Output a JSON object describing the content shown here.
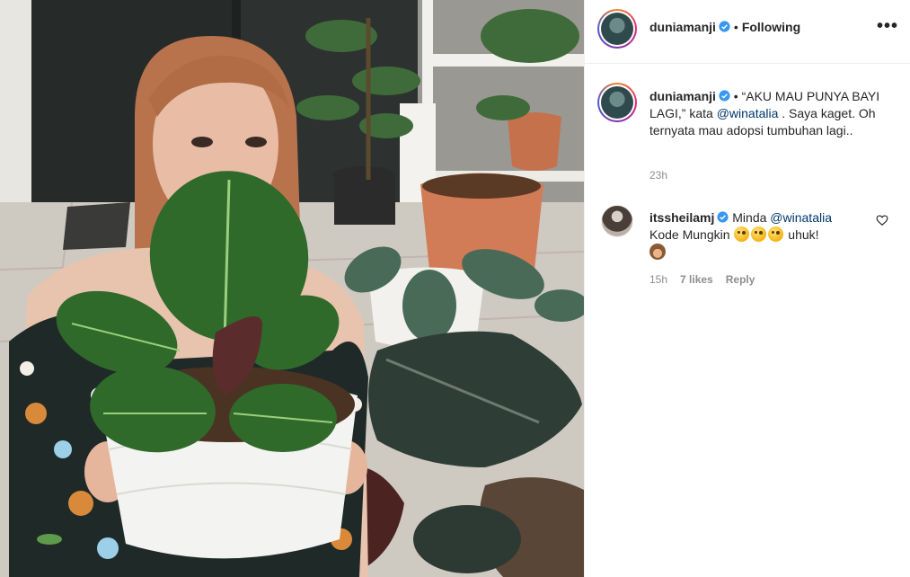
{
  "post": {
    "author": "duniamanji",
    "separator": "•",
    "follow_status": "Following",
    "more_glyph": "•••"
  },
  "caption": {
    "username": "duniamanji",
    "prefix": " • “AKU MAU PUNYA BAYI LAGI,” kata ",
    "mention": "@winatalia",
    "suffix": " . Saya kaget. Oh ternyata mau adopsi tumbuhan lagi..",
    "time": "23h"
  },
  "comment": {
    "username": "itssheilamj",
    "prefix": " Minda ",
    "mention": "@winatalia",
    "line2_start": "Kode Mungkin ",
    "line2_end": " uhuk!",
    "time": "15h",
    "likes": "7 likes",
    "reply": "Reply"
  },
  "icons": {
    "verified": "verified-badge-icon",
    "heart": "heart-outline-icon",
    "more": "more-options-icon",
    "emoji_face": "zany-face-emoji",
    "emoji_monkey": "see-no-evil-monkey-emoji"
  },
  "colors": {
    "verified_blue": "#3897f0",
    "mention_blue": "#00376b",
    "secondary_text": "#8e8e8e",
    "border": "#efefef"
  }
}
